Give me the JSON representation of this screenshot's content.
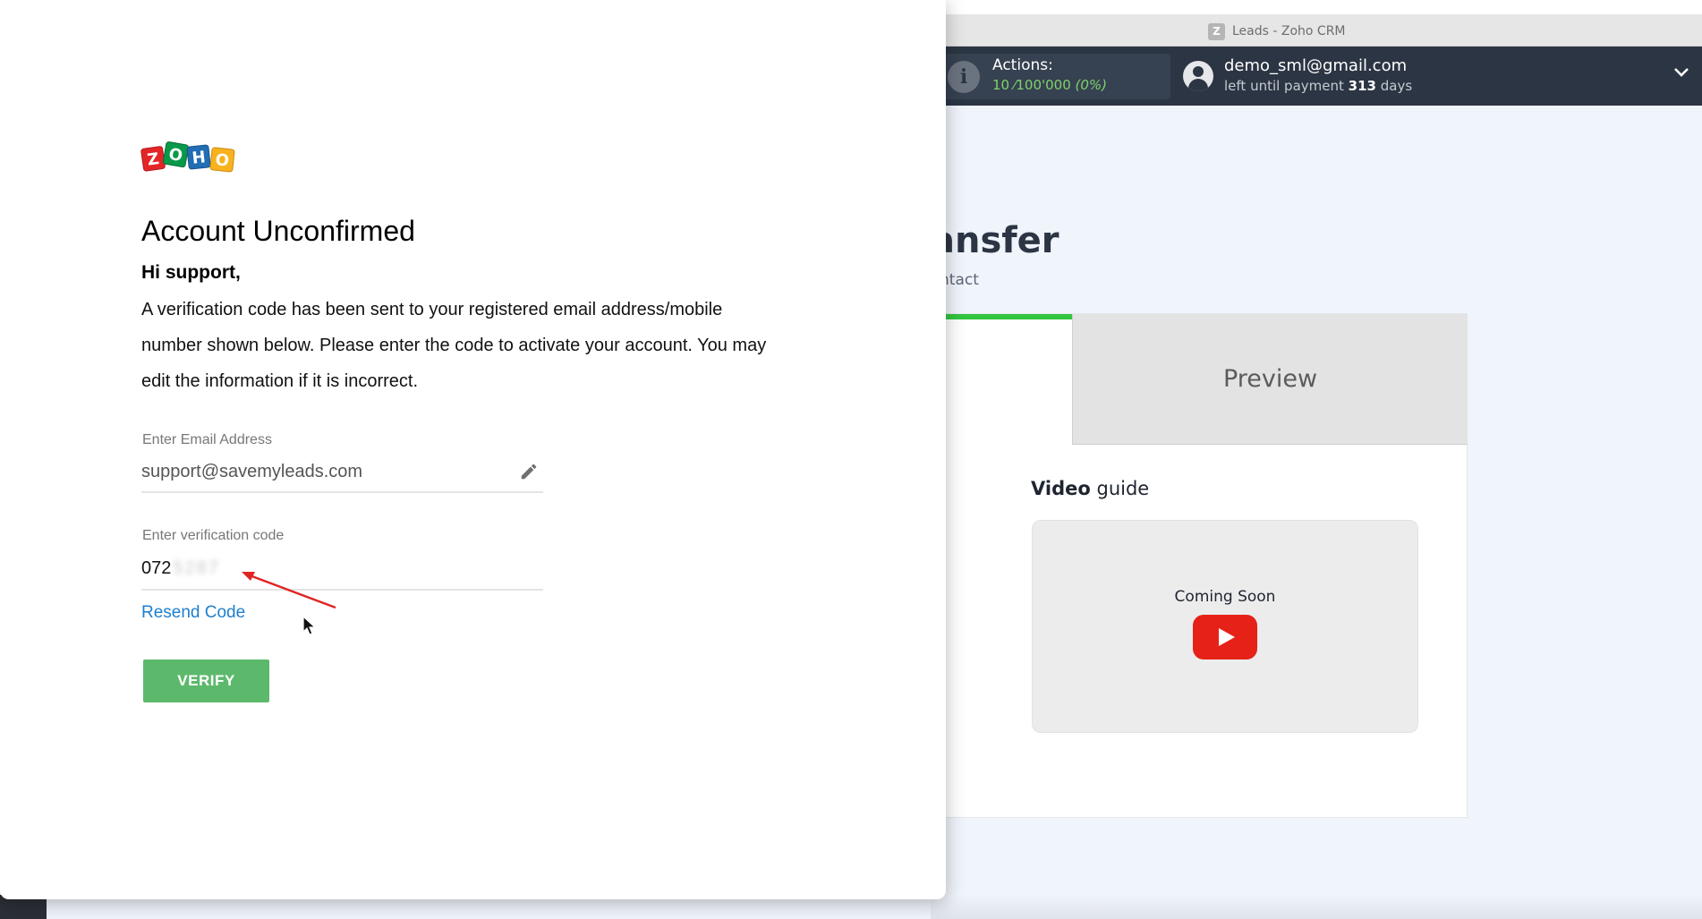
{
  "background_app": {
    "window_title": "Leads - Zoho CRM",
    "window_icon_letter": "Z",
    "actions": {
      "label": "Actions:",
      "value": "10 ⁄100'000",
      "percent": "(0%)"
    },
    "user": {
      "email": "demo_sml@gmail.com",
      "payment_prefix": "left until payment",
      "payment_days": "313",
      "payment_suffix": "days"
    },
    "page_heading_fragment": "ansfer",
    "page_subheading_fragment": "ntact",
    "tabs": {
      "preview_label": "Preview"
    },
    "video_guide": {
      "title_bold": "Video",
      "title_rest": "guide",
      "coming_soon": "Coming Soon"
    },
    "icons": [
      "info-icon",
      "user-icon",
      "chevron-down-icon",
      "youtube-play-icon"
    ],
    "colors": {
      "topbar": "#2c3543",
      "progress_green": "#33c53f",
      "youtube_red": "#e62117"
    }
  },
  "popup": {
    "logo_letters": [
      "Z",
      "O",
      "H",
      "O"
    ],
    "title": "Account Unconfirmed",
    "greeting": "Hi support,",
    "message_lines": [
      "A verification code has been sent to your registered email address/mobile",
      "number shown below. Please enter the code to activate your account. You may",
      "edit the information if it is incorrect."
    ],
    "email_field": {
      "label": "Enter Email Address",
      "value": "support@savemyleads.com"
    },
    "code_field": {
      "label": "Enter verification code",
      "visible_value": "072",
      "blurred_value": "5287"
    },
    "resend_label": "Resend Code",
    "verify_label": "VERIFY",
    "colors": {
      "verify_green": "#5cb96c",
      "link_blue": "#1d7fce",
      "annotation_red": "#e02424"
    }
  }
}
